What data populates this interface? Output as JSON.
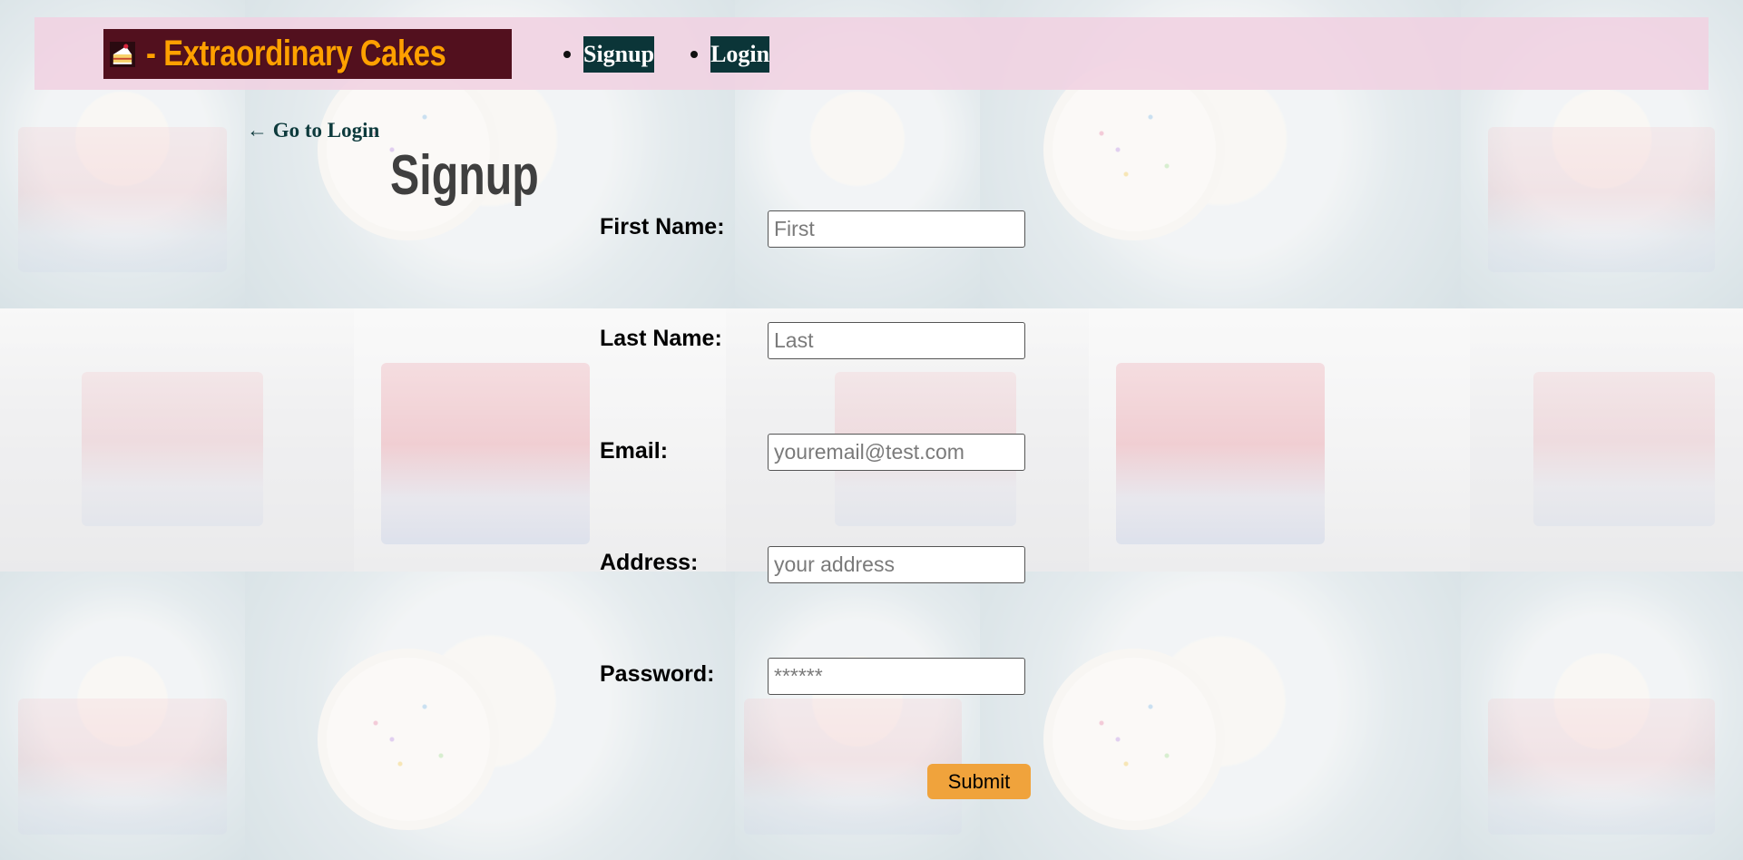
{
  "header": {
    "brand": "- Extraordinary Cakes",
    "logo_icon": "cake-slice-icon",
    "nav": [
      {
        "label": "Signup"
      },
      {
        "label": "Login"
      }
    ]
  },
  "back_link": "← Go to Login",
  "title": "Signup",
  "form": {
    "fields": [
      {
        "label": "First Name:",
        "placeholder": "First",
        "type": "text"
      },
      {
        "label": "Last Name:",
        "placeholder": "Last",
        "type": "text"
      },
      {
        "label": "Email:",
        "placeholder": "youremail@test.com",
        "type": "email"
      },
      {
        "label": "Address:",
        "placeholder": "your address",
        "type": "text"
      },
      {
        "label": "Password:",
        "placeholder": "******",
        "type": "password"
      }
    ],
    "submit_label": "Submit"
  },
  "colors": {
    "header_bg": "#f0d2e1",
    "logo_bg": "#52101e",
    "brand_text": "#ffa000",
    "nav_bg": "#0b3538",
    "submit_bg": "#f0a33c"
  }
}
